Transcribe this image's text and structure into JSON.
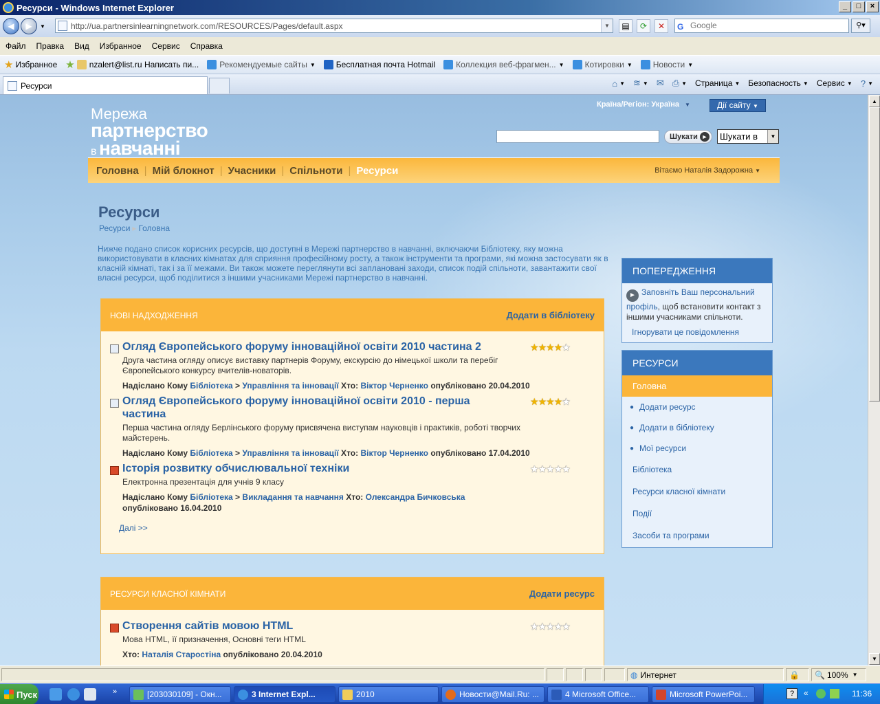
{
  "window": {
    "title": "Ресурси - Windows Internet Explorer",
    "minimize": "_",
    "maximize": "□",
    "close": "×"
  },
  "address": {
    "url": "http://ua.partnersinlearningnetwork.com/RESOURCES/Pages/default.aspx",
    "search_placeholder": "Google"
  },
  "menu": [
    "Файл",
    "Правка",
    "Вид",
    "Избранное",
    "Сервис",
    "Справка"
  ],
  "favorites": {
    "label": "Избранное",
    "items": [
      "nzalert@list.ru Написать пи...",
      "Рекомендуемые сайты",
      "Бесплатная почта Hotmail",
      "Коллекция веб-фрагмен...",
      "Котировки",
      "Новости"
    ]
  },
  "tab": {
    "title": "Ресурси"
  },
  "commands": [
    "Страница",
    "Безопасность",
    "Сервис"
  ],
  "site": {
    "logo": {
      "line1": "Мережа",
      "line2": "партнерство",
      "line3_small": "в",
      "line3": "навчанні"
    },
    "region": "Країна/Регіон: Україна",
    "site_actions": "Дії сайту",
    "search_button": "Шукати",
    "search_scope": "Шукати в",
    "nav": [
      "Головна",
      "Мій блокнот",
      "Учасники",
      "Спільноти",
      "Ресурси"
    ],
    "greeting": "Вітаємо Наталія Задорожна"
  },
  "page": {
    "title": "Ресурси",
    "breadcrumb": [
      "Ресурси",
      "Головна"
    ],
    "intro": "Нижче подано список корисних ресурсів, що доступні в Мережі партнерство в навчанні, включаючи Бібліотеку, яку можна використовувати в класних кімнатах для сприяння професійному росту, а також інструменти та програми, які можна застосувати як в класній кімнаті, так і за її межами. Ви також можете переглянути всі заплановані заходи, список подій спільноти, завантажити свої власні ресурси, щоб поділитися з іншими учасниками Мережі партнерство в навчанні."
  },
  "new_arrivals": {
    "heading": "НОВІ НАДХОДЖЕННЯ",
    "action": "Додати в бібліотеку",
    "items": [
      {
        "title": "Огляд Європейського форуму інноваційної освіти 2010 частина 2",
        "desc": "Друга частина огляду описує виставку партнерів Форуму, екскурсію до німецької школи та перебіг Європейського конкурсу вчителів-новаторів.",
        "sent_label": "Надіслано Кому",
        "library": "Бібліотека",
        "arrow": ">",
        "category": "Управління та інновації",
        "who_label": "Хто:",
        "author": "Віктор Черненко",
        "published": "опубліковано 20.04.2010",
        "rating": 4
      },
      {
        "title": "Огляд Європейського форуму інноваційної освіти 2010 - перша частина",
        "desc": "Перша частина огляду Берлінського форуму присвячена виступам науковців і практиків, роботі творчих майстерень.",
        "sent_label": "Надіслано Кому",
        "library": "Бібліотека",
        "arrow": ">",
        "category": "Управління та інновації",
        "who_label": "Хто:",
        "author": "Віктор Черненко",
        "published": "опубліковано 17.04.2010",
        "rating": 4
      },
      {
        "title": "Історія розвитку обчислювальної техніки",
        "desc": "Електронна презентація для учнів 9 класу",
        "sent_label": "Надіслано Кому",
        "library": "Бібліотека",
        "arrow": ">",
        "category": "Викладання та навчання",
        "who_label": "Хто:",
        "author": "Олександра Бичковська",
        "published": "опубліковано 16.04.2010",
        "rating": 0
      }
    ],
    "more": "Далі >>"
  },
  "classroom": {
    "heading": "РЕСУРСИ КЛАСНОЇ КІМНАТИ",
    "action": "Додати ресурс",
    "items": [
      {
        "title": "Створення сайтів мовою HTML",
        "desc": "Мова HTML, її призначення, Основні теги HTML",
        "who_label": "Хто:",
        "author": "Наталія Старостіна",
        "published": "опубліковано 20.04.2010",
        "rating": 0
      }
    ]
  },
  "warnings": {
    "heading": "ПОПЕРЕДЖЕННЯ",
    "link": "Заповніть Ваш персональний профіль",
    "text": ", щоб встановити контакт з іншими учасниками спільноти.",
    "ignore": "Ігнорувати це повідомлення"
  },
  "resources_nav": {
    "heading": "РЕСУРСИ",
    "selected": "Головна",
    "sub": [
      "Додати ресурс",
      "Додати в бібліотеку",
      "Мої ресурси"
    ],
    "links": [
      "Бібліотека",
      "Ресурси класної кімнати",
      "Події",
      "Засоби та програми"
    ]
  },
  "status": {
    "zone": "Интернет",
    "zoom": "100%"
  },
  "taskbar": {
    "start": "Пуск",
    "tasks": [
      "[203030109] - Окн...",
      "3 Internet Expl...",
      "2010",
      "Новости@Mail.Ru: ...",
      "4 Microsoft Office...",
      "Microsoft PowerPoi..."
    ],
    "lang": "EN",
    "clock": "11:36"
  },
  "colors": {
    "accent_orange": "#fbb53a",
    "link_blue": "#2a63a5",
    "panel_blue": "#3b78bd"
  }
}
